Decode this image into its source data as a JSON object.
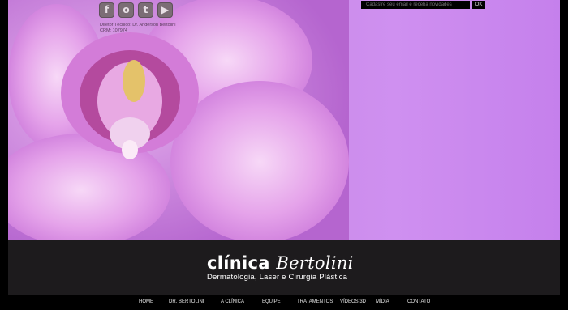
{
  "social": {
    "icons": [
      "facebook-icon",
      "orkut-icon",
      "twitter-icon",
      "youtube-icon"
    ],
    "glyphs": [
      "f",
      "o",
      "t",
      "▶"
    ]
  },
  "credit": {
    "line1": "Diretor Técnico: Dr. Anderson Bertolini",
    "line2": "CRM: 107974"
  },
  "newsletter": {
    "placeholder": "Cadastre seu email e receba novidades",
    "submit": "OK"
  },
  "brand": {
    "name_part1": "clínica",
    "name_part2": "Bertolini",
    "tagline": "Dermatologia, Laser e Cirurgia Plástica"
  },
  "nav": {
    "items": [
      "HOME",
      "DR. BERTOLINI",
      "A CLÍNICA",
      "EQUIPE",
      "TRATAMENTOS",
      "VÍDEOS 3D",
      "MÍDIA",
      "CONTATO"
    ]
  },
  "colors": {
    "background": "#000000",
    "sky": "#c889e6",
    "banner": "#1d1b1d",
    "petal": "#e9a6ee"
  }
}
